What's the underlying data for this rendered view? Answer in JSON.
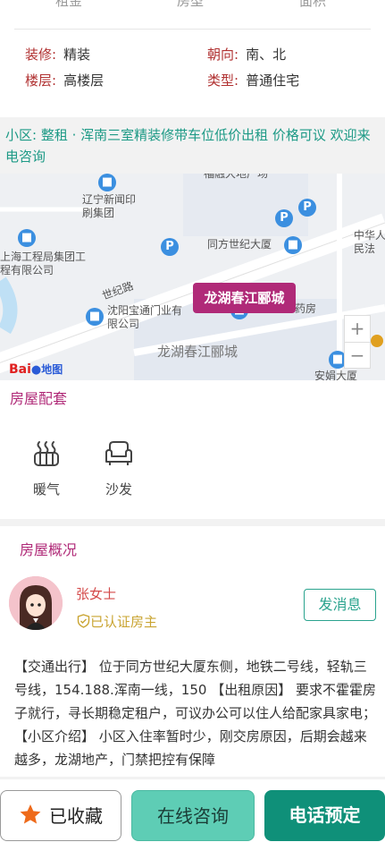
{
  "top": {
    "cut_labels": [
      "租金",
      "房型",
      "面积"
    ],
    "attrs": [
      {
        "key": "装修:",
        "value": "精装"
      },
      {
        "key": "朝向:",
        "value": "南、北"
      },
      {
        "key": "楼层:",
        "value": "高楼层"
      },
      {
        "key": "类型:",
        "value": "普通住宅"
      }
    ]
  },
  "community": {
    "text": "小区: 整租 · 浑南三室精装修带车位低价出租 价格可议 欢迎来电咨询"
  },
  "map": {
    "labels": [
      "辽宁新闻印刷集团",
      "上海工程局集团工程有限公司",
      "世纪路",
      "同方世纪大厦",
      "沈阳宝通门业有限公司",
      "龙湖春江郦城",
      "中华人民法",
      "安娟大厦",
      "福融大地广场",
      "药房"
    ],
    "marker_label": "龙湖春江郦城",
    "zoom_in": "+",
    "zoom_out": "−",
    "logo_text": "Bai",
    "logo_text2": "地图"
  },
  "facilities": {
    "title": "房屋配套",
    "items": [
      {
        "label": "暖气",
        "icon": "radiator-icon"
      },
      {
        "label": "沙发",
        "icon": "sofa-icon"
      }
    ]
  },
  "overview": {
    "title": "房屋概况",
    "owner_name": "张女士",
    "verified_label": "已认证房主",
    "message_button": "发消息",
    "description": "【交通出行】 位于同方世纪大厦东侧，地铁二号线，轻轨三号线，154.188.浑南一线，150 【出租原因】 要求不霍霍房子就行，寻长期稳定租户，可议办公可以住人给配家具家电；【小区介绍】 小区入住率暂时少，刚交房原因，后期会越来越多，龙湖地产，门禁把控有保障"
  },
  "bottom": {
    "favorite": "已收藏",
    "consult": "在线咨询",
    "book": "电话预定"
  },
  "colors": {
    "accent_green": "#0f9079",
    "magenta": "#b02a78",
    "label_red": "#b03030"
  }
}
